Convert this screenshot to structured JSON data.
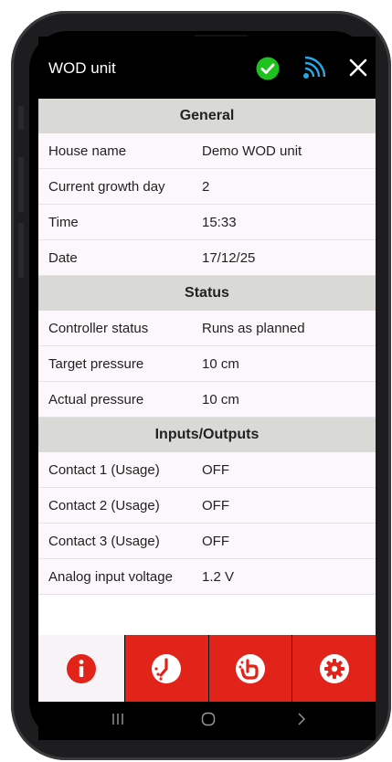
{
  "app": {
    "title": "WOD unit"
  },
  "colors": {
    "accent": "#e2231a",
    "status_ok": "#1ec21e",
    "wifi": "#2aa7e0",
    "section_bg": "#d9d9d6",
    "row_bg": "#fcf7fb"
  },
  "header_icons": [
    "check-circle-icon",
    "wifi-icon",
    "close-icon"
  ],
  "sections": [
    {
      "title": "General",
      "rows": [
        {
          "label": "House name",
          "value": "Demo WOD unit"
        },
        {
          "label": "Current growth day",
          "value": "2"
        },
        {
          "label": "Time",
          "value": "15:33"
        },
        {
          "label": "Date",
          "value": "17/12/25"
        }
      ]
    },
    {
      "title": "Status",
      "rows": [
        {
          "label": "Controller status",
          "value": "Runs as planned"
        },
        {
          "label": "Target pressure",
          "value": "10 cm"
        },
        {
          "label": "Actual pressure",
          "value": "10 cm"
        }
      ]
    },
    {
      "title": "Inputs/Outputs",
      "rows": [
        {
          "label": "Contact 1 (Usage)",
          "value": "OFF"
        },
        {
          "label": "Contact 2 (Usage)",
          "value": "OFF"
        },
        {
          "label": "Contact 3 (Usage)",
          "value": "OFF"
        },
        {
          "label": "Analog input voltage",
          "value": "1.2 V"
        }
      ]
    }
  ],
  "tabs": [
    {
      "icon": "info-icon",
      "active": true
    },
    {
      "icon": "clock-icon",
      "active": false
    },
    {
      "icon": "hand-icon",
      "active": false
    },
    {
      "icon": "settings-gear-icon",
      "active": false
    }
  ],
  "system_nav": [
    "recent-apps-icon",
    "home-icon",
    "back-icon"
  ]
}
